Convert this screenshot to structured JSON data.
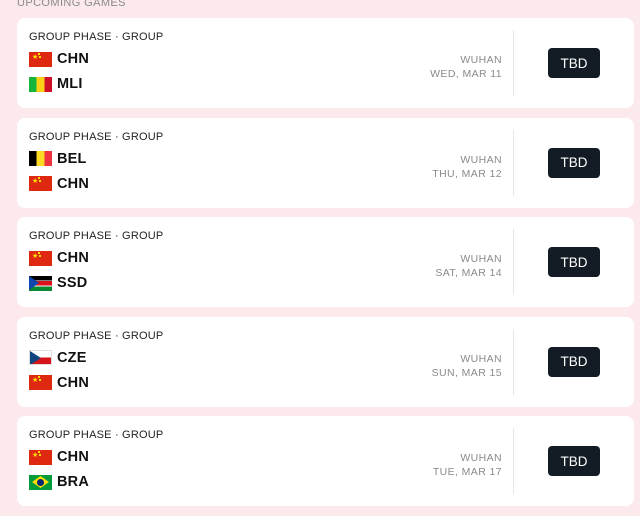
{
  "section_title": "UPCOMING GAMES",
  "games": [
    {
      "phase": "GROUP PHASE · GROUP",
      "team1": {
        "code": "CHN",
        "flag": "china-flag-icon"
      },
      "team2": {
        "code": "MLI",
        "flag": "mali-flag-icon"
      },
      "city": "WUHAN",
      "date": "WED, MAR 11",
      "button": "TBD"
    },
    {
      "phase": "GROUP PHASE · GROUP",
      "team1": {
        "code": "BEL",
        "flag": "belgium-flag-icon"
      },
      "team2": {
        "code": "CHN",
        "flag": "china-flag-icon"
      },
      "city": "WUHAN",
      "date": "THU, MAR 12",
      "button": "TBD"
    },
    {
      "phase": "GROUP PHASE · GROUP",
      "team1": {
        "code": "CHN",
        "flag": "china-flag-icon"
      },
      "team2": {
        "code": "SSD",
        "flag": "south-sudan-flag-icon"
      },
      "city": "WUHAN",
      "date": "SAT, MAR 14",
      "button": "TBD"
    },
    {
      "phase": "GROUP PHASE · GROUP",
      "team1": {
        "code": "CZE",
        "flag": "czechia-flag-icon"
      },
      "team2": {
        "code": "CHN",
        "flag": "china-flag-icon"
      },
      "city": "WUHAN",
      "date": "SUN, MAR 15",
      "button": "TBD"
    },
    {
      "phase": "GROUP PHASE · GROUP",
      "team1": {
        "code": "CHN",
        "flag": "china-flag-icon"
      },
      "team2": {
        "code": "BRA",
        "flag": "brazil-flag-icon"
      },
      "city": "WUHAN",
      "date": "TUE, MAR 17",
      "button": "TBD"
    }
  ],
  "colors": {
    "background": "#fbe9ec",
    "card": "#ffffff",
    "button": "#131c24",
    "muted_text": "#8a8a8a"
  }
}
